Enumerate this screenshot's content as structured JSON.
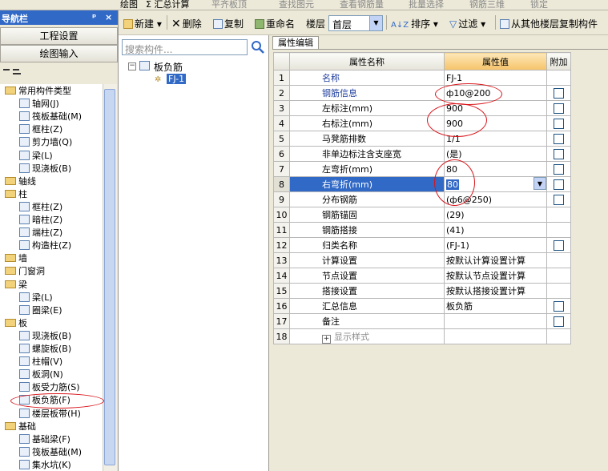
{
  "topbar": {
    "items": [
      "绘图",
      "Σ 汇总计算",
      "平齐板顶",
      "查找图元",
      "查看钢筋量",
      "批量选择",
      "钢筋三维",
      "锁定"
    ]
  },
  "left_panel": {
    "title": "导航栏",
    "pin": "ᵖ",
    "close": "×",
    "buttons": [
      "工程设置",
      "绘图输入"
    ],
    "tree": [
      {
        "label": "常用构件类型",
        "level": 0,
        "type": "folder"
      },
      {
        "label": "轴网(J)",
        "level": 1,
        "type": "item"
      },
      {
        "label": "筏板基础(M)",
        "level": 1,
        "type": "item"
      },
      {
        "label": "框柱(Z)",
        "level": 1,
        "type": "item"
      },
      {
        "label": "剪力墙(Q)",
        "level": 1,
        "type": "item"
      },
      {
        "label": "梁(L)",
        "level": 1,
        "type": "item"
      },
      {
        "label": "现浇板(B)",
        "level": 1,
        "type": "item"
      },
      {
        "label": "轴线",
        "level": 0,
        "type": "folder"
      },
      {
        "label": "柱",
        "level": 0,
        "type": "folder"
      },
      {
        "label": "框柱(Z)",
        "level": 1,
        "type": "item"
      },
      {
        "label": "暗柱(Z)",
        "level": 1,
        "type": "item"
      },
      {
        "label": "端柱(Z)",
        "level": 1,
        "type": "item"
      },
      {
        "label": "构造柱(Z)",
        "level": 1,
        "type": "item"
      },
      {
        "label": "墙",
        "level": 0,
        "type": "folder"
      },
      {
        "label": "门窗洞",
        "level": 0,
        "type": "folder"
      },
      {
        "label": "梁",
        "level": 0,
        "type": "folder"
      },
      {
        "label": "梁(L)",
        "level": 1,
        "type": "item"
      },
      {
        "label": "圈梁(E)",
        "level": 1,
        "type": "item"
      },
      {
        "label": "板",
        "level": 0,
        "type": "folder"
      },
      {
        "label": "现浇板(B)",
        "level": 1,
        "type": "item"
      },
      {
        "label": "螺旋板(B)",
        "level": 1,
        "type": "item"
      },
      {
        "label": "柱帽(V)",
        "level": 1,
        "type": "item"
      },
      {
        "label": "板洞(N)",
        "level": 1,
        "type": "item"
      },
      {
        "label": "板受力筋(S)",
        "level": 1,
        "type": "item"
      },
      {
        "label": "板负筋(F)",
        "level": 1,
        "type": "item"
      },
      {
        "label": "楼层板带(H)",
        "level": 1,
        "type": "item"
      },
      {
        "label": "基础",
        "level": 0,
        "type": "folder"
      },
      {
        "label": "基础梁(F)",
        "level": 1,
        "type": "item"
      },
      {
        "label": "筏板基础(M)",
        "level": 1,
        "type": "item"
      },
      {
        "label": "集水坑(K)",
        "level": 1,
        "type": "item"
      }
    ]
  },
  "toolbar": {
    "new_label": "新建",
    "delete_label": "删除",
    "copy_label": "复制",
    "rename_label": "重命名",
    "floor_label": "楼层",
    "floor_value": "首层",
    "sort_label": "排序",
    "filter_label": "过滤",
    "copy_from_label": "从其他楼层复制构件"
  },
  "middle_panel": {
    "search_placeholder": "搜索构件...",
    "tree_root": "板负筋",
    "tree_child": "FJ-1"
  },
  "right_panel": {
    "tab": "属性编辑",
    "columns": [
      "",
      "属性名称",
      "属性值",
      "附加"
    ],
    "rows": [
      {
        "n": "1",
        "name": "名称",
        "value": "FJ-1",
        "check": false,
        "blue": true
      },
      {
        "n": "2",
        "name": "钢筋信息",
        "value": "ф10@200",
        "check": true,
        "blue": true
      },
      {
        "n": "3",
        "name": "左标注(mm)",
        "value": "900",
        "check": true,
        "blue": false
      },
      {
        "n": "4",
        "name": "右标注(mm)",
        "value": "900",
        "check": true,
        "blue": false
      },
      {
        "n": "5",
        "name": "马凳筋排数",
        "value": "1/1",
        "check": true,
        "blue": false
      },
      {
        "n": "6",
        "name": "非单边标注含支座宽",
        "value": "(是)",
        "check": true,
        "blue": false
      },
      {
        "n": "7",
        "name": "左弯折(mm)",
        "value": "80",
        "check": true,
        "blue": false
      },
      {
        "n": "8",
        "name": "右弯折(mm)",
        "value": "80",
        "check": true,
        "blue": false
      },
      {
        "n": "9",
        "name": "分布钢筋",
        "value": "(ф6@250)",
        "check": true,
        "blue": false
      },
      {
        "n": "10",
        "name": "钢筋锚固",
        "value": "(29)",
        "check": false,
        "blue": false
      },
      {
        "n": "11",
        "name": "钢筋搭接",
        "value": "(41)",
        "check": false,
        "blue": false
      },
      {
        "n": "12",
        "name": "归类名称",
        "value": "(FJ-1)",
        "check": true,
        "blue": false
      },
      {
        "n": "13",
        "name": "计算设置",
        "value": "按默认计算设置计算",
        "check": false,
        "blue": false
      },
      {
        "n": "14",
        "name": "节点设置",
        "value": "按默认节点设置计算",
        "check": false,
        "blue": false
      },
      {
        "n": "15",
        "name": "搭接设置",
        "value": "按默认搭接设置计算",
        "check": false,
        "blue": false
      },
      {
        "n": "16",
        "name": "汇总信息",
        "value": "板负筋",
        "check": true,
        "blue": false
      },
      {
        "n": "17",
        "name": "备注",
        "value": "",
        "check": true,
        "blue": false
      },
      {
        "n": "18",
        "name": "显示样式",
        "value": "",
        "check": false,
        "blue": false
      }
    ],
    "selected_row": "8"
  },
  "colors": {
    "selection": "#3169c6",
    "annotation": "#d8141a",
    "header_highlight": "#f6c46a"
  }
}
